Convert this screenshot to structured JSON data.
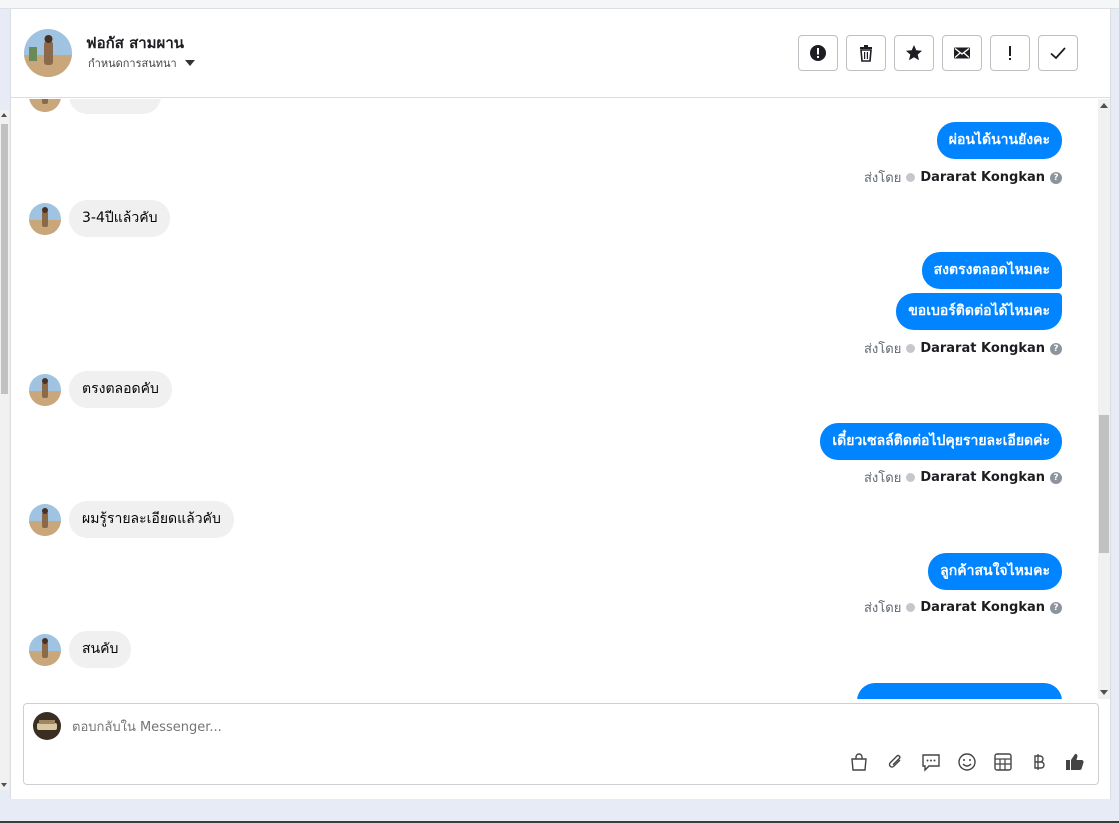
{
  "header": {
    "contact_name": "ฟอกัส สามผาน",
    "assign_label": "กำหนดการสนทนา",
    "buttons": [
      "report",
      "delete",
      "star",
      "mark-unread",
      "spam",
      "done"
    ]
  },
  "messages": [
    {
      "dir": "in",
      "text": ""
    },
    {
      "dir": "out",
      "text": "ผ่อนได้นานยังคะ"
    },
    {
      "dir": "sent_by",
      "label": "ส่งโดย",
      "name": "Dararat Kongkan"
    },
    {
      "dir": "in",
      "text": "3-4ปีแล้วคับ"
    },
    {
      "dir": "out",
      "text": "สงตรงตลอดไหมคะ"
    },
    {
      "dir": "out",
      "text": "ขอเบอร์ติดต่อได้ไหมคะ"
    },
    {
      "dir": "sent_by",
      "label": "ส่งโดย",
      "name": "Dararat Kongkan"
    },
    {
      "dir": "in",
      "text": "ตรงตลอดคับ"
    },
    {
      "dir": "out",
      "text": "เดี๋ยวเซลล์ติดต่อไปคุยรายละเอียดค่ะ"
    },
    {
      "dir": "sent_by",
      "label": "ส่งโดย",
      "name": "Dararat Kongkan"
    },
    {
      "dir": "in",
      "text": "ผมรู้รายละเอียดแล้วคับ"
    },
    {
      "dir": "out",
      "text": "ลูกค้าสนใจไหมคะ"
    },
    {
      "dir": "sent_by",
      "label": "ส่งโดย",
      "name": "Dararat Kongkan"
    },
    {
      "dir": "in",
      "text": "สนคับ"
    }
  ],
  "composer": {
    "placeholder": "ตอบกลับใน Messenger...",
    "tools": [
      "shopping-bag",
      "attachment",
      "saved-reply",
      "emoji",
      "appointment",
      "payment",
      "like"
    ]
  },
  "colors": {
    "outgoing_bubble": "#0084ff",
    "incoming_bubble": "#f0f0f0"
  }
}
